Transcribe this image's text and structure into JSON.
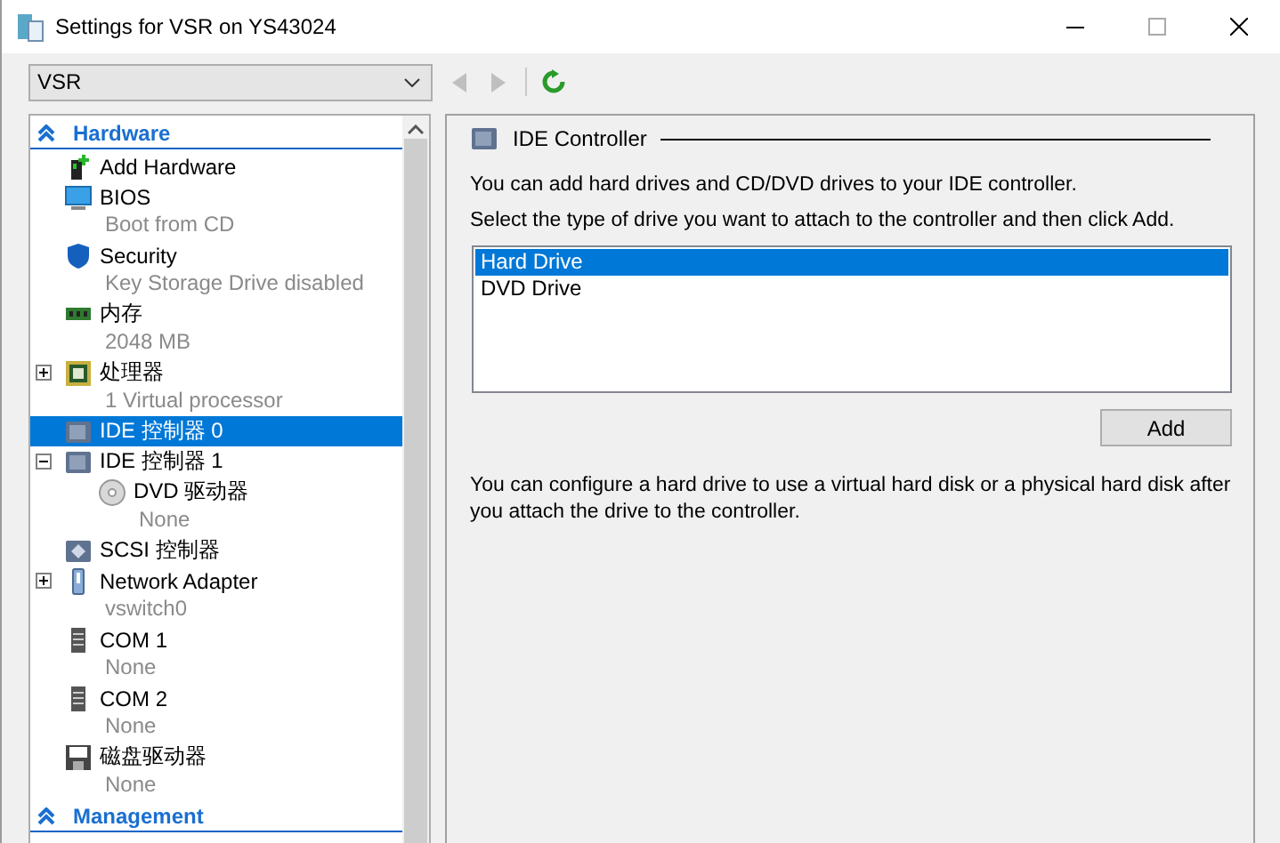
{
  "window": {
    "title": "Settings for VSR on YS43024"
  },
  "vm_selector": {
    "value": "VSR"
  },
  "toolbar": {
    "back_disabled": true,
    "forward_disabled": true
  },
  "tree": [
    {
      "kind": "section",
      "label": "Hardware",
      "expanded": true,
      "children": [
        {
          "kind": "add-hardware",
          "label": "Add Hardware",
          "selected": false
        },
        {
          "kind": "bios",
          "label": "BIOS",
          "detail": "Boot from CD",
          "selected": false
        },
        {
          "kind": "shield",
          "label": "Security",
          "detail": "Key Storage Drive disabled",
          "selected": false
        },
        {
          "kind": "memory",
          "label": "内存",
          "detail": "2048 MB",
          "selected": false
        },
        {
          "kind": "chip",
          "label": "处理器",
          "detail": "1 Virtual processor",
          "selected": false,
          "expanded": false
        },
        {
          "kind": "controller",
          "label": "IDE 控制器 0",
          "selected": true
        },
        {
          "kind": "controller",
          "label": "IDE 控制器 1",
          "selected": false,
          "expanded": true,
          "children": [
            {
              "kind": "disc",
              "label": "DVD 驱动器",
              "detail": "None",
              "selected": false
            }
          ]
        },
        {
          "kind": "scsi",
          "label": "SCSI 控制器",
          "selected": false
        },
        {
          "kind": "network",
          "label": "Network Adapter",
          "detail": "vswitch0",
          "selected": false,
          "expanded": false
        },
        {
          "kind": "port",
          "label": "COM 1",
          "detail": "None",
          "selected": false
        },
        {
          "kind": "port",
          "label": "COM 2",
          "detail": "None",
          "selected": false
        },
        {
          "kind": "floppy",
          "label": "磁盘驱动器",
          "detail": "None",
          "selected": false
        }
      ]
    },
    {
      "kind": "section",
      "label": "Management",
      "expanded": true
    }
  ],
  "panel": {
    "title": "IDE Controller",
    "intro": "You can add hard drives and CD/DVD drives to your IDE controller.",
    "instruction": "Select the type of drive you want to attach to the controller and then click Add.",
    "drive_types": [
      {
        "label": "Hard Drive",
        "selected": true
      },
      {
        "label": "DVD Drive",
        "selected": false
      }
    ],
    "add_button": "Add",
    "note": "You can configure a hard drive to use a virtual hard disk or a physical hard disk after you attach the drive to the controller."
  }
}
